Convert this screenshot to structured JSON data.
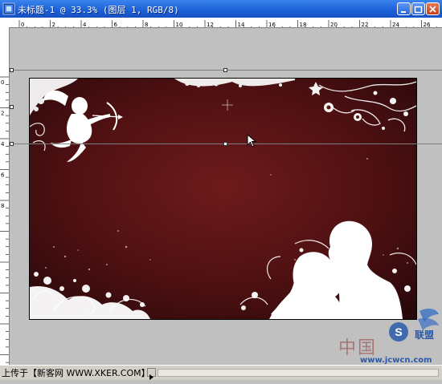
{
  "window": {
    "title": "未标题-1 @ 33.3% (图层 1, RGB/8)"
  },
  "statusbar": {
    "text": "上传于【新客网 WWW.XKER.COM】"
  },
  "watermark": {
    "cn_text": "中国",
    "url_text": "www.jcwcn.com",
    "logo_label": "联盟"
  },
  "rulers": {
    "top_labels": [
      "0",
      "2",
      "4",
      "6",
      "8",
      "10",
      "12",
      "14",
      "16",
      "18",
      "20",
      "22",
      "24",
      "26"
    ],
    "left_labels": [
      "0",
      "2",
      "4",
      "6",
      "8"
    ]
  },
  "colors": {
    "title_bar": "#1c5fd6",
    "canvas_bg": "#5a1414",
    "silhouette": "#ffffff",
    "workspace": "#c0c0c0"
  },
  "icons": [
    "photoshop-document-icon",
    "minimize-icon",
    "maximize-icon",
    "close-icon",
    "mouse-cursor-icon"
  ]
}
